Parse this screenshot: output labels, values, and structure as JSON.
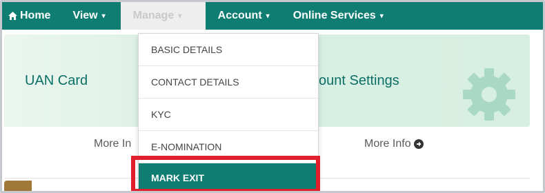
{
  "navbar": {
    "items": [
      {
        "label": "Home",
        "icon": "home-icon"
      },
      {
        "label": "View",
        "caret": "▾"
      },
      {
        "label": "Manage",
        "caret": "▾"
      },
      {
        "label": "Account",
        "caret": "▾"
      },
      {
        "label": "Online Services",
        "caret": "▾"
      }
    ]
  },
  "dashboard": {
    "uan_card": "UAN Card",
    "account_settings": "ount Settings",
    "more_info_left": "More In",
    "more_info_right": "More Info"
  },
  "dropdown": {
    "items": [
      {
        "label": "BASIC DETAILS"
      },
      {
        "label": "CONTACT DETAILS"
      },
      {
        "label": "KYC"
      },
      {
        "label": "E-NOMINATION"
      },
      {
        "label": "MARK EXIT",
        "active": true
      }
    ]
  },
  "colors": {
    "navbar": "#0f7d72",
    "highlight": "#e01e2c",
    "heading": "#0b6f66"
  }
}
